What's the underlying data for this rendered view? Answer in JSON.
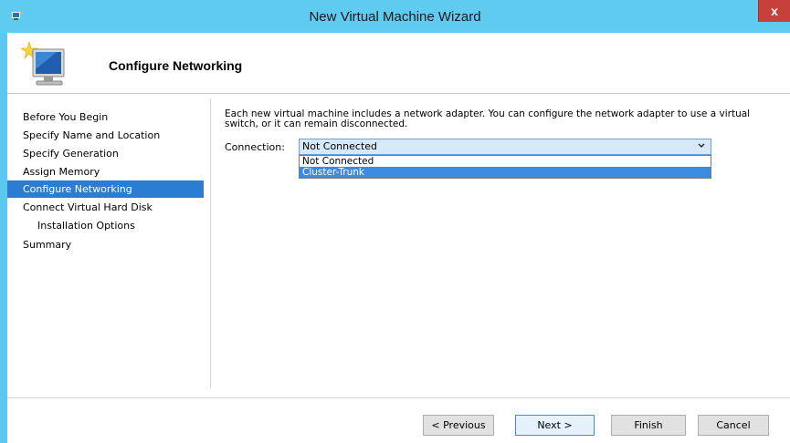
{
  "window": {
    "title": "New Virtual Machine Wizard",
    "close_glyph": "x"
  },
  "header": {
    "title": "Configure Networking"
  },
  "nav": {
    "items": [
      {
        "label": "Before You Begin"
      },
      {
        "label": "Specify Name and Location"
      },
      {
        "label": "Specify Generation"
      },
      {
        "label": "Assign Memory"
      },
      {
        "label": "Configure Networking"
      },
      {
        "label": "Connect Virtual Hard Disk"
      },
      {
        "label": "Installation Options"
      },
      {
        "label": "Summary"
      }
    ],
    "active": "Configure Networking"
  },
  "content": {
    "description": "Each new virtual machine includes a network adapter. You can configure the network adapter to use a virtual switch, or it can remain disconnected.",
    "connection_label": "Connection:",
    "connection_value": "Not Connected",
    "options": [
      {
        "label": "Not Connected"
      },
      {
        "label": "Cluster-Trunk"
      }
    ],
    "highlighted_option": "Cluster-Trunk"
  },
  "buttons": {
    "previous": "< Previous",
    "next": "Next >",
    "finish": "Finish",
    "cancel": "Cancel"
  },
  "colors": {
    "titlebar": "#5fcbf1",
    "close": "#c7403b",
    "nav_active": "#2a7dd1",
    "dropdown_highlight": "#3b8ce0"
  }
}
